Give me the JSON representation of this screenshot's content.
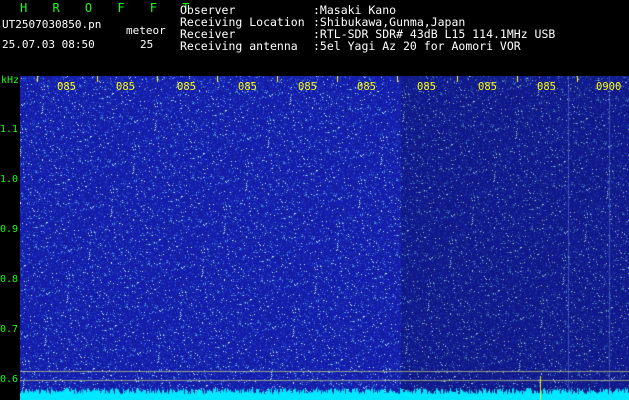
{
  "header": {
    "brand": "H R O F F T",
    "filename": "UT2507030850.pn",
    "event_type": "meteor",
    "datetime": "25.07.03 08:50",
    "count": "25",
    "fields": [
      {
        "label": "Observer",
        "value": ":Masaki Kano"
      },
      {
        "label": "Receiving Location",
        "value": ":Shibukawa,Gunma,Japan"
      },
      {
        "label": "Receiver",
        "value": ":RTL-SDR SDR# 43dB L15 114.1MHz USB"
      },
      {
        "label": "Receiving antenna",
        "value": ":5el Yagi Az 20 for Aomori VOR"
      }
    ]
  },
  "axes": {
    "y_unit": "kHz",
    "y_ticks": [
      "1.1",
      "1.0",
      "0.9",
      "0.8",
      "0.7",
      "0.6"
    ],
    "x_ticks": [
      "085",
      "085",
      "085",
      "085",
      "085",
      "085",
      "085",
      "085",
      "085",
      "0900"
    ]
  },
  "colors": {
    "label": "#18ff18",
    "axis_text": "#ffff00",
    "background": "#000000",
    "waterfall_base": "#1a23a8",
    "noise_band": "#00e8ff"
  }
}
